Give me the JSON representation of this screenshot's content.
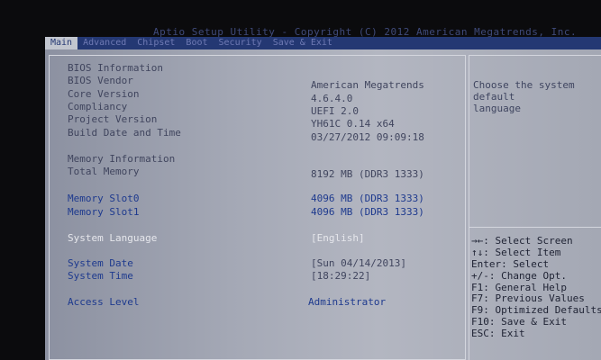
{
  "title": "Aptio Setup Utility - Copyright (C) 2012 American Megatrends, Inc.",
  "tabs": [
    "Main",
    "Advanced",
    "Chipset",
    "Boot",
    "Security",
    "Save & Exit"
  ],
  "main": {
    "bios_info_header": "BIOS Information",
    "bios_vendor_label": "BIOS Vendor",
    "bios_vendor_value": "American Megatrends",
    "core_version_label": "Core Version",
    "core_version_value": "4.6.4.0",
    "compliancy_label": "Compliancy",
    "compliancy_value": "UEFI 2.0",
    "project_version_label": "Project Version",
    "project_version_value": "YH61C 0.14 x64",
    "build_date_label": "Build Date and Time",
    "build_date_value": "03/27/2012 09:09:18",
    "memory_info_header": "Memory Information",
    "total_memory_label": "Total Memory",
    "total_memory_value": "8192 MB (DDR3 1333)",
    "slot0_label": "Memory Slot0",
    "slot0_value": "4096 MB (DDR3 1333)",
    "slot1_label": "Memory Slot1",
    "slot1_value": "4096 MB (DDR3 1333)",
    "system_language_label": "System Language",
    "system_language_value": "[English]",
    "system_date_label": "System Date",
    "system_date_value": "[Sun 04/14/2013]",
    "system_time_label": "System Time",
    "system_time_value": "[18:29:22]",
    "access_level_label": "Access Level",
    "access_level_value": "Administrator"
  },
  "help": {
    "line1": "Choose the system default",
    "line2": "language"
  },
  "keys": [
    "→←: Select Screen",
    "↑↓: Select Item",
    "Enter: Select",
    "+/-: Change Opt.",
    "F1: General Help",
    "F7: Previous Values",
    "F9: Optimized Defaults",
    "F10: Save & Exit",
    "ESC: Exit"
  ],
  "colors": {
    "screen_bg": "#a5a9b6",
    "tab_bar_bg": "#243873",
    "label_blue": "#1e3a8e",
    "selected_white": "#e6e7ec"
  }
}
